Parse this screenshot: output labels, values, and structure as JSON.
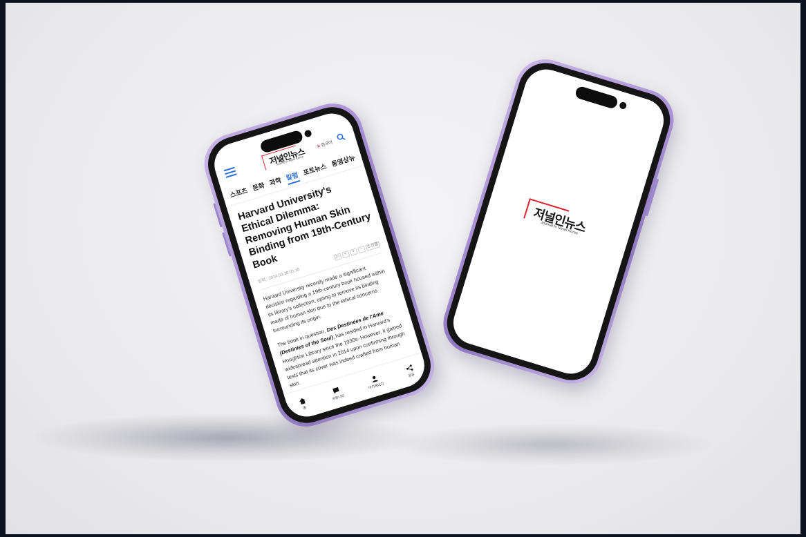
{
  "left_phone": {
    "logo_text": "저널인뉴스",
    "logo_sub": "Journal In News Korea",
    "language": "한국어",
    "language_flag": "✕",
    "nav_items": [
      "스포츠",
      "문화",
      "과학",
      "칼럼",
      "포토뉴스",
      "동영상뉴"
    ],
    "active_nav": 3,
    "headline": "Harvard University's Ethical Dilemma: Removing Human Skin Binding from 19th-Century Book",
    "date": "입력 : 2024.03.30 05:18",
    "tools": [
      "▭",
      "<",
      "+",
      "−",
      "스크랩"
    ],
    "paragraph_1": "Harvard University recently made a significant decision regarding a 19th-century book housed within its library's collection, opting to remove its binding made of human skin due to the ethical concerns surrounding its origin.",
    "paragraph_2_start": "The book in question, ",
    "paragraph_2_title": "Des Destinées de l'Ame (Destinies of the Soul)",
    "paragraph_2_end": ", has resided in Harvard's Houghton Library since the 1930s. However, it gained widespread attention in 2014 upon confirming through tests that its cover was indeed crafted from human skin.",
    "tabbar": [
      {
        "label": "홈",
        "icon": "home-icon"
      },
      {
        "label": "커뮤니티",
        "icon": "chat-icon"
      },
      {
        "label": "마이페이지",
        "icon": "person-icon"
      },
      {
        "label": "공유",
        "icon": "share-icon"
      }
    ]
  },
  "right_phone": {
    "logo_text": "저널인뉴스",
    "logo_sub": "Journal In News Korea"
  },
  "colors": {
    "brand_red": "#d9232d",
    "accent_blue": "#2a6de0",
    "frame_purple": "#a98fd4"
  }
}
